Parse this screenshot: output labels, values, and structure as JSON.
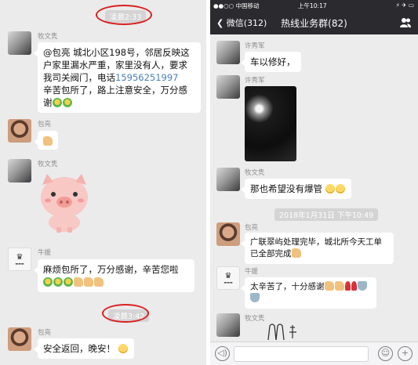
{
  "left": {
    "time_1": "凌晨2:33",
    "msg_1": {
      "sender": "牧文隽",
      "lines": [
        "@包亮 城北小区198号，邻居反映这",
        "户家里漏水严重，家里没有人，要求",
        "我司关阀门，电话",
        "辛苦包所了，路上注意安全，万分感",
        "谢"
      ],
      "phone": "15956251997"
    },
    "msg_2": {
      "sender": "包亮"
    },
    "msg_3": {
      "sender": "牧文隽",
      "sticker": "pink-pig-sticker"
    },
    "msg_4": {
      "sender": "牛媛",
      "lines": [
        "麻烦包所了，万分感谢，辛苦您啦"
      ]
    },
    "time_2": "凌晨3:42",
    "msg_5": {
      "sender": "包亮",
      "text": "安全返回，晚安！"
    }
  },
  "right": {
    "statusbar": {
      "carrier": "●●○○ 中国移动",
      "time": "上午10:17",
      "battery": "⚡ ✈ ▭"
    },
    "nav": {
      "back_label": "微信(312)",
      "title": "热线业务群(82)"
    },
    "msg_1": {
      "sender": "许秀军",
      "text": "车以修好，"
    },
    "msg_2": {
      "sender": "许秀军"
    },
    "msg_3": {
      "sender": "牧文隽",
      "text": "那也希望没有爆管"
    },
    "time_1": "2018年1月31日 下午10:49",
    "msg_4": {
      "sender": "包亮",
      "lines": [
        "广联翠屿处理完毕，城北所今天工单",
        "已全部完成"
      ]
    },
    "msg_5": {
      "sender": "牛媛",
      "text": "太辛苦了，十分感谢"
    },
    "msg_6": {
      "sender": "牧文隽"
    }
  },
  "colors": {
    "ring": "#d9201f",
    "link": "#4a7fb5",
    "nav_bg": "#2b2b2f",
    "chat_bg": "#ebebeb"
  },
  "icons": [
    "chevron-left-icon",
    "group-people-icon",
    "voice-icon",
    "emoji-icon",
    "plus-icon"
  ]
}
